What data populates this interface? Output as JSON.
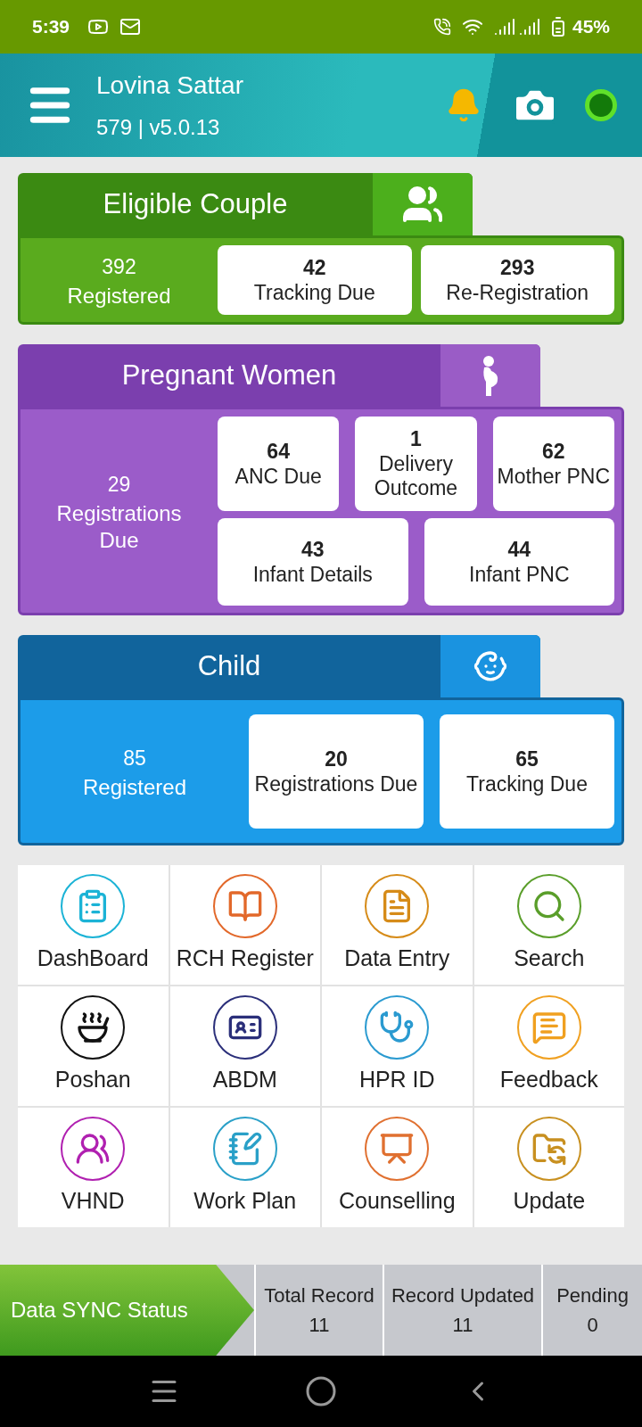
{
  "status_bar": {
    "time": "5:39",
    "battery": "45%"
  },
  "header": {
    "name": "Lovina Sattar",
    "subtitle": "579 | v5.0.13"
  },
  "sections": [
    {
      "kind": "couple",
      "title": "Eligible Couple",
      "summary": {
        "count": "392",
        "label": "Registered"
      },
      "tiles": [
        {
          "count": "42",
          "label": "Tracking Due"
        },
        {
          "count": "293",
          "label": "Re-Registration"
        }
      ]
    },
    {
      "kind": "pregnant",
      "title": "Pregnant Women",
      "summary": {
        "count": "29",
        "label": "Registrations Due"
      },
      "tiles": [
        {
          "count": "64",
          "label": "ANC Due"
        },
        {
          "count": "1",
          "label": "Delivery Outcome"
        },
        {
          "count": "62",
          "label": "Mother PNC"
        },
        {
          "count": "43",
          "label": "Infant Details"
        },
        {
          "count": "44",
          "label": "Infant PNC"
        }
      ]
    },
    {
      "kind": "child",
      "title": "Child",
      "summary": {
        "count": "85",
        "label": "Registered"
      },
      "tiles": [
        {
          "count": "20",
          "label": "Registrations Due"
        },
        {
          "count": "65",
          "label": "Tracking Due"
        }
      ]
    }
  ],
  "menu": [
    {
      "label": "DashBoard"
    },
    {
      "label": "RCH Register"
    },
    {
      "label": "Data Entry"
    },
    {
      "label": "Search"
    },
    {
      "label": "Poshan"
    },
    {
      "label": "ABDM"
    },
    {
      "label": "HPR ID"
    },
    {
      "label": "Feedback"
    },
    {
      "label": "VHND"
    },
    {
      "label": "Work Plan"
    },
    {
      "label": "Counselling"
    },
    {
      "label": "Update"
    }
  ],
  "sync": {
    "title": "Data SYNC Status",
    "stats": [
      {
        "label": "Total Record",
        "value": "11"
      },
      {
        "label": "Record Updated",
        "value": "11"
      },
      {
        "label": "Pending",
        "value": "0"
      }
    ]
  }
}
